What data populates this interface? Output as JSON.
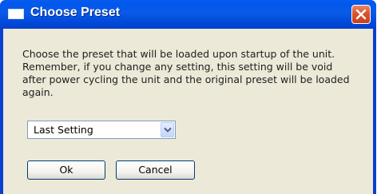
{
  "window": {
    "title": "Choose Preset",
    "title_icon": "window-icon",
    "close_icon": "close-icon"
  },
  "message": "Choose the preset that will be loaded upon startup of the unit. Remember, if you change any setting, this setting will be void after power cycling the unit and the original preset will be loaded again.",
  "preset_select": {
    "selected_value": "Last Setting",
    "arrow_icon": "chevron-down-icon"
  },
  "buttons": {
    "ok_label": "Ok",
    "cancel_label": "Cancel"
  },
  "colors": {
    "titlebar": "#0058ee",
    "close_button": "#d8532c",
    "dialog_background": "#ece9d8"
  }
}
